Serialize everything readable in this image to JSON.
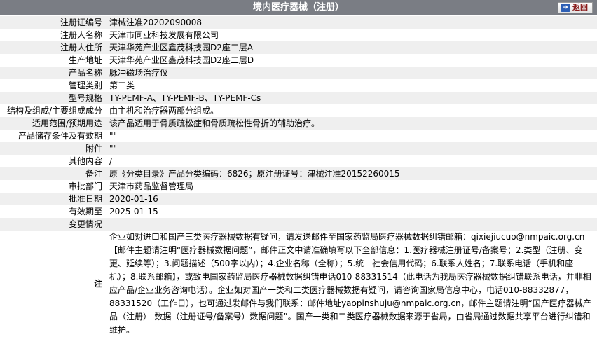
{
  "header": {
    "title": "境内医疗器械（注册）",
    "back_label": "返回"
  },
  "rows": [
    {
      "label": "注册证编号",
      "value": "津械注准20202090008"
    },
    {
      "label": "注册人名称",
      "value": "天津市同业科技发展有限公司"
    },
    {
      "label": "注册人住所",
      "value": "天津华苑产业区鑫茂科技园D2座二层A"
    },
    {
      "label": "生产地址",
      "value": "天津华苑产业区鑫茂科技园D2座二层D"
    },
    {
      "label": "产品名称",
      "value": "脉冲磁场治疗仪"
    },
    {
      "label": "管理类别",
      "value": "第二类"
    },
    {
      "label": "型号规格",
      "value": "TY-PEMF-A、TY-PEMF-B、TY-PEMF-Cs"
    },
    {
      "label": "结构及组成/主要组成成分",
      "value": "由主机和治疗器两部分组成。"
    },
    {
      "label": "适用范围/预期用途",
      "value": "该产品适用于骨质疏松症和骨质疏松性骨折的辅助治疗。"
    },
    {
      "label": "产品储存条件及有效期",
      "value": "\"\""
    },
    {
      "label": "附件",
      "value": "\"\""
    },
    {
      "label": "其他内容",
      "value": "/"
    },
    {
      "label": "备注",
      "value": "原《分类目录》产品分类编码：6826；原注册证号：津械注准20152260015"
    },
    {
      "label": "审批部门",
      "value": "天津市药品监督管理局"
    },
    {
      "label": "批准日期",
      "value": "2020-01-16"
    },
    {
      "label": "有效期至",
      "value": "2025-01-15"
    },
    {
      "label": "变更情况",
      "value": ""
    }
  ],
  "note": {
    "label": "注",
    "text": "企业如对进口和国产三类医疗器械数据有疑问，请发送邮件至国家药监局医疗器械数据纠错邮箱：qixiejiucuo@nmpaic.org.cn【邮件主题请注明“医疗器械数据问题”，邮件正文中请准确填写以下全部信息：1.医疗器械注册证号/备案号；2.类型（注册、变更、延续等）；3.问题描述（500字以内）；4.企业名称（全称）；5.统一社会信用代码；6.联系人姓名；7.联系电话（手机和座机）；8.联系邮箱】，或致电国家药监局医疗器械数据纠错电话010-88331514（此电话为我局医疗器械数据纠错联系电话，并非相应产品/企业业务咨询电话）。企业如对国产一类和二类医疗器械数据有疑问，请咨询国家局信息中心，电话010-88332877，88331520（工作日），也可通过发邮件与我们联系：邮件地址yaopinshuju@nmpaic.org.cn，邮件主题请注明“国产医疗器械产品（注册）-数据（注册证号/备案号）数据问题”。国产一类和二类医疗器械数据来源于省局，由省局通过数据共享平台进行纠错和维护。"
  }
}
